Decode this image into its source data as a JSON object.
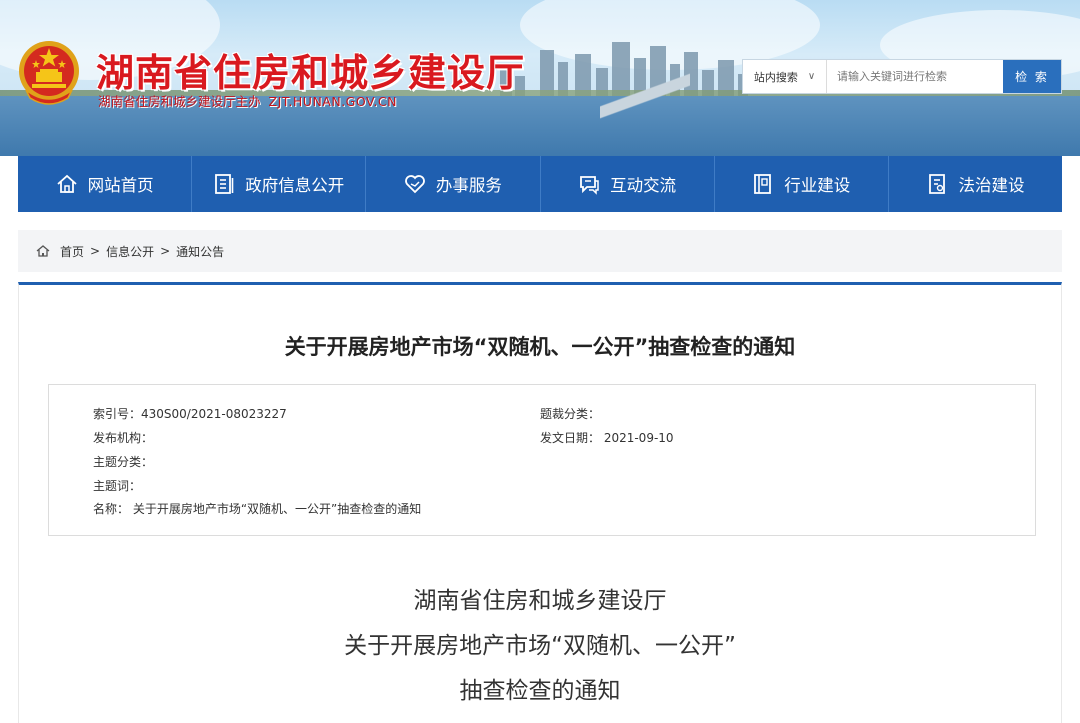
{
  "site": {
    "title": "湖南省住房和城乡建设厅",
    "sponsor": "湖南省住房和城乡建设厅主办",
    "domain": "ZJT.HUNAN.GOV.CN"
  },
  "search": {
    "scope_label": "站内搜索",
    "scope_chevron": "∨",
    "placeholder": "请输入关键词进行检索",
    "button_label": "检 索"
  },
  "nav": {
    "items": [
      {
        "label": "网站首页",
        "icon": "home-icon"
      },
      {
        "label": "政府信息公开",
        "icon": "document-list-icon"
      },
      {
        "label": "办事服务",
        "icon": "heart-icon"
      },
      {
        "label": "互动交流",
        "icon": "chat-icon"
      },
      {
        "label": "行业建设",
        "icon": "book-icon"
      },
      {
        "label": "法治建设",
        "icon": "law-document-icon"
      }
    ]
  },
  "breadcrumb": {
    "items": [
      "首页",
      "信息公开",
      "通知公告"
    ],
    "separator": ">"
  },
  "article": {
    "title": "关于开展房地产市场“双随机、一公开”抽查检查的通知",
    "meta": {
      "index_no": "索引号：430S00/2021-08023227",
      "category": "题裁分类：",
      "issuer": "发布机构：",
      "date": "发文日期： 2021-09-10",
      "topic": "主题分类：",
      "keywords": "主题词：",
      "name": "名称： 关于开展房地产市场“双随机、一公开”抽查检查的通知"
    },
    "heading_lines": [
      "湖南省住房和城乡建设厅",
      "关于开展房地产市场“双随机、一公开”",
      "抽查检查的通知"
    ]
  },
  "colors": {
    "brand_red": "#d9191f",
    "nav_blue": "#1f5fb0",
    "search_button": "#2a6fbd",
    "breadcrumb_bg": "#f3f4f6"
  }
}
